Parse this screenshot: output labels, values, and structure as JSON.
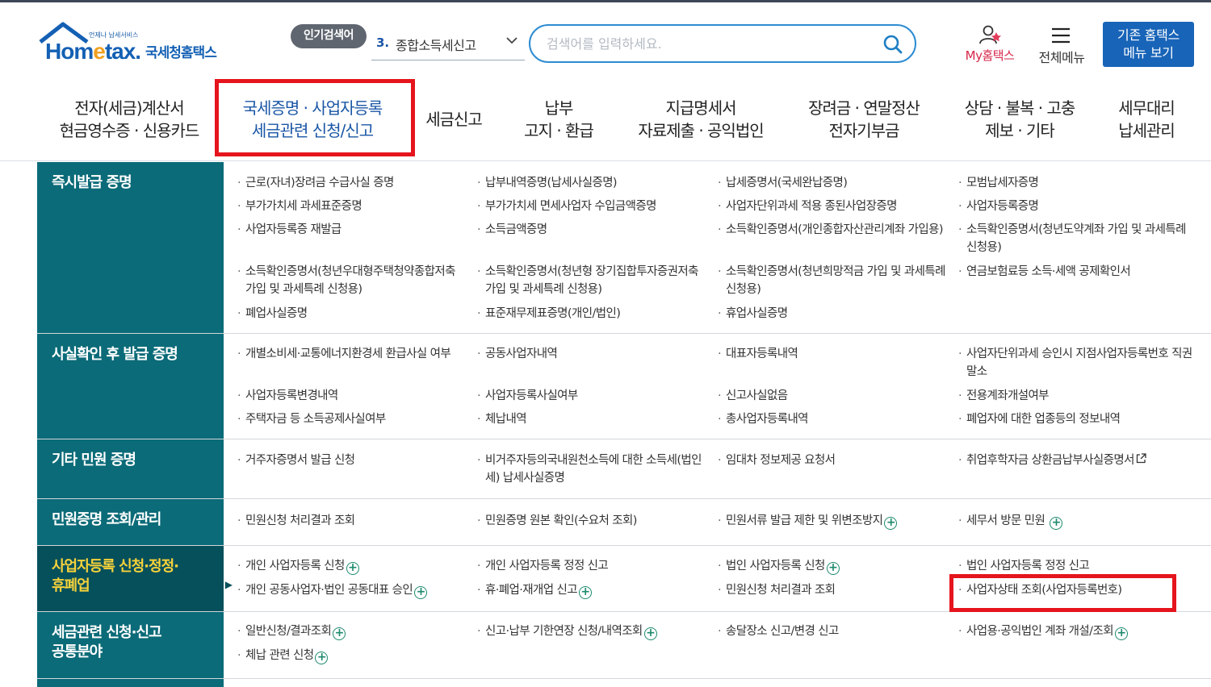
{
  "header": {
    "logo_tagline": "언제나 납세서비스",
    "logo_brand_a": "Hom",
    "logo_brand_e": "e",
    "logo_brand_b": "tax.",
    "logo_brand_kr": "국세청홈택스",
    "popular_label": "인기검색어",
    "popular_rank": "3.",
    "popular_term": "종합소득세신고",
    "search_placeholder": "검색어를 입력하세요.",
    "my_hometax": "My홈택스",
    "all_menu": "전체메뉴",
    "old_menu_line1": "기존 홈택스",
    "old_menu_line2": "메뉴 보기"
  },
  "gnb": [
    {
      "l1": "전자(세금)계산서",
      "l2": "현금영수증 · 신용카드"
    },
    {
      "l1": "국세증명 · 사업자등록",
      "l2": "세금관련 신청/신고"
    },
    {
      "l1": "세금신고",
      "l2": ""
    },
    {
      "l1": "납부",
      "l2": "고지 · 환급"
    },
    {
      "l1": "지급명세서",
      "l2": "자료제출 · 공익법인"
    },
    {
      "l1": "장려금 · 연말정산",
      "l2": "전자기부금"
    },
    {
      "l1": "상담 · 불복 · 고충",
      "l2": "제보 · 기타"
    },
    {
      "l1": "세무대리",
      "l2": "납세관리"
    }
  ],
  "sections": [
    {
      "title": "즉시발급 증명",
      "items": [
        [
          "근로(자녀)장려금 수급사실 증명",
          "납부내역증명(납세사실증명)",
          "납세증명서(국세완납증명)",
          "모범납세자증명"
        ],
        [
          "부가가치세 과세표준증명",
          "부가가치세 면세사업자 수입금액증명",
          "사업자단위과세 적용 종된사업장증명",
          "사업자등록증명"
        ],
        [
          "사업자등록증 재발급",
          "소득금액증명",
          "소득확인증명서(개인종합자산관리계좌 가입용)",
          "소득확인증명서(청년도약계좌 가입 및 과세특례 신청용)"
        ],
        [
          "소득확인증명서(청년우대형주택청약종합저축 가입 및 과세특례 신청용)",
          "소득확인증명서(청년형 장기집합투자증권저축 가입 및 과세특례 신청용)",
          "소득확인증명서(청년희망적금 가입 및 과세특례 신청용)",
          "연금보험료등 소득·세액 공제확인서"
        ],
        [
          "폐업사실증명",
          "표준재무제표증명(개인/법인)",
          "휴업사실증명",
          ""
        ]
      ]
    },
    {
      "title": "사실확인 후 발급 증명",
      "items": [
        [
          "개별소비세·교통에너지환경세 환급사실 여부",
          "공동사업자내역",
          "대표자등록내역",
          "사업자단위과세 승인시 지점사업자등록번호 직권말소"
        ],
        [
          "사업자등록변경내역",
          "사업자등록사실여부",
          "신고사실없음",
          "전용계좌개설여부"
        ],
        [
          "주택자금 등 소득공제사실여부",
          "체납내역",
          "총사업자등록내역",
          "폐업자에 대한 업종등의 정보내역"
        ]
      ]
    },
    {
      "title": "기타 민원 증명",
      "items": [
        [
          "거주자증명서 발급 신청",
          "비거주자등의국내원천소득에 대한 소득세(법인세) 납세사실증명",
          "임대차 정보제공 요청서",
          "취업후학자금 상환금납부사실증명서"
        ]
      ]
    },
    {
      "title": "민원증명 조회/관리",
      "items": [
        [
          "민원신청 처리결과 조회",
          "민원증명 원본 확인(수요처 조회)",
          "민원서류 발급 제한 및 위변조방지",
          "세무서 방문 민원"
        ]
      ]
    },
    {
      "title_l1": "사업자등록 신청·정정·",
      "title_l2": "휴폐업",
      "items": [
        [
          "개인 사업자등록 신청",
          "개인 사업자등록 정정 신고",
          "법인 사업자등록 신청",
          "법인 사업자등록 정정 신고"
        ],
        [
          "개인 공동사업자·법인 공동대표 승인",
          "휴·폐업·재개업 신고",
          "민원신청 처리결과 조회",
          "사업자상태 조회(사업자등록번호)"
        ]
      ]
    },
    {
      "title_l1": "세금관련 신청·신고",
      "title_l2": "공통분야",
      "items": [
        [
          "일반신청/결과조회",
          "신고·납부 기한연장 신청/내역조회",
          "송달장소 신고/변경 신고",
          "사업용·공익법인 계좌 개설/조회"
        ],
        [
          "체납 관련 신청",
          "",
          "",
          ""
        ]
      ]
    }
  ],
  "colors": {
    "accent_blue": "#1864b8",
    "teal_head": "#0b6b78",
    "selected_head": "#06505b",
    "selected_text": "#f7d23a",
    "highlight_red": "#e5141d",
    "plus_green": "#1e8a6e"
  }
}
